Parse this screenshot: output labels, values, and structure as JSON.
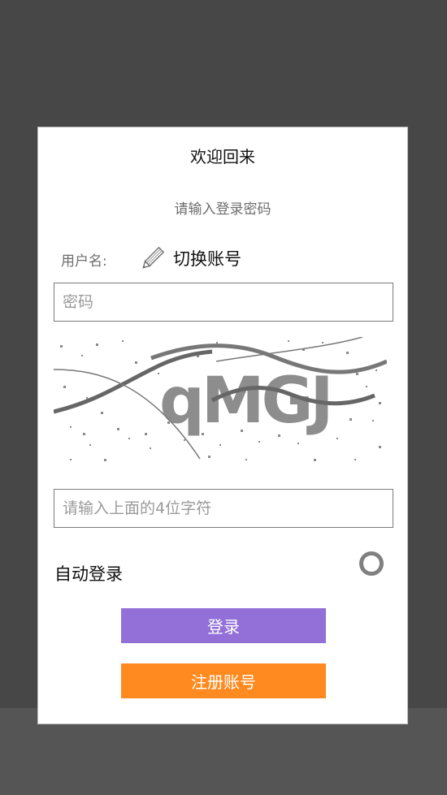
{
  "dialog": {
    "title": "欢迎回来",
    "subtitle": "请输入登录密码",
    "username_label": "用户名:",
    "switch_account": "切换账号",
    "password_placeholder": "密码",
    "captcha_text": "qMGJ",
    "captcha_placeholder": "请输入上面的4位字符",
    "auto_login_label": "自动登录",
    "login_button": "登录",
    "register_button": "注册账号"
  },
  "colors": {
    "background": "#474747",
    "login_button": "#9270d8",
    "register_button": "#ff8a1f"
  },
  "icons": {
    "switch_account": "pencil-icon",
    "auto_login": "radio-toggle-icon"
  }
}
